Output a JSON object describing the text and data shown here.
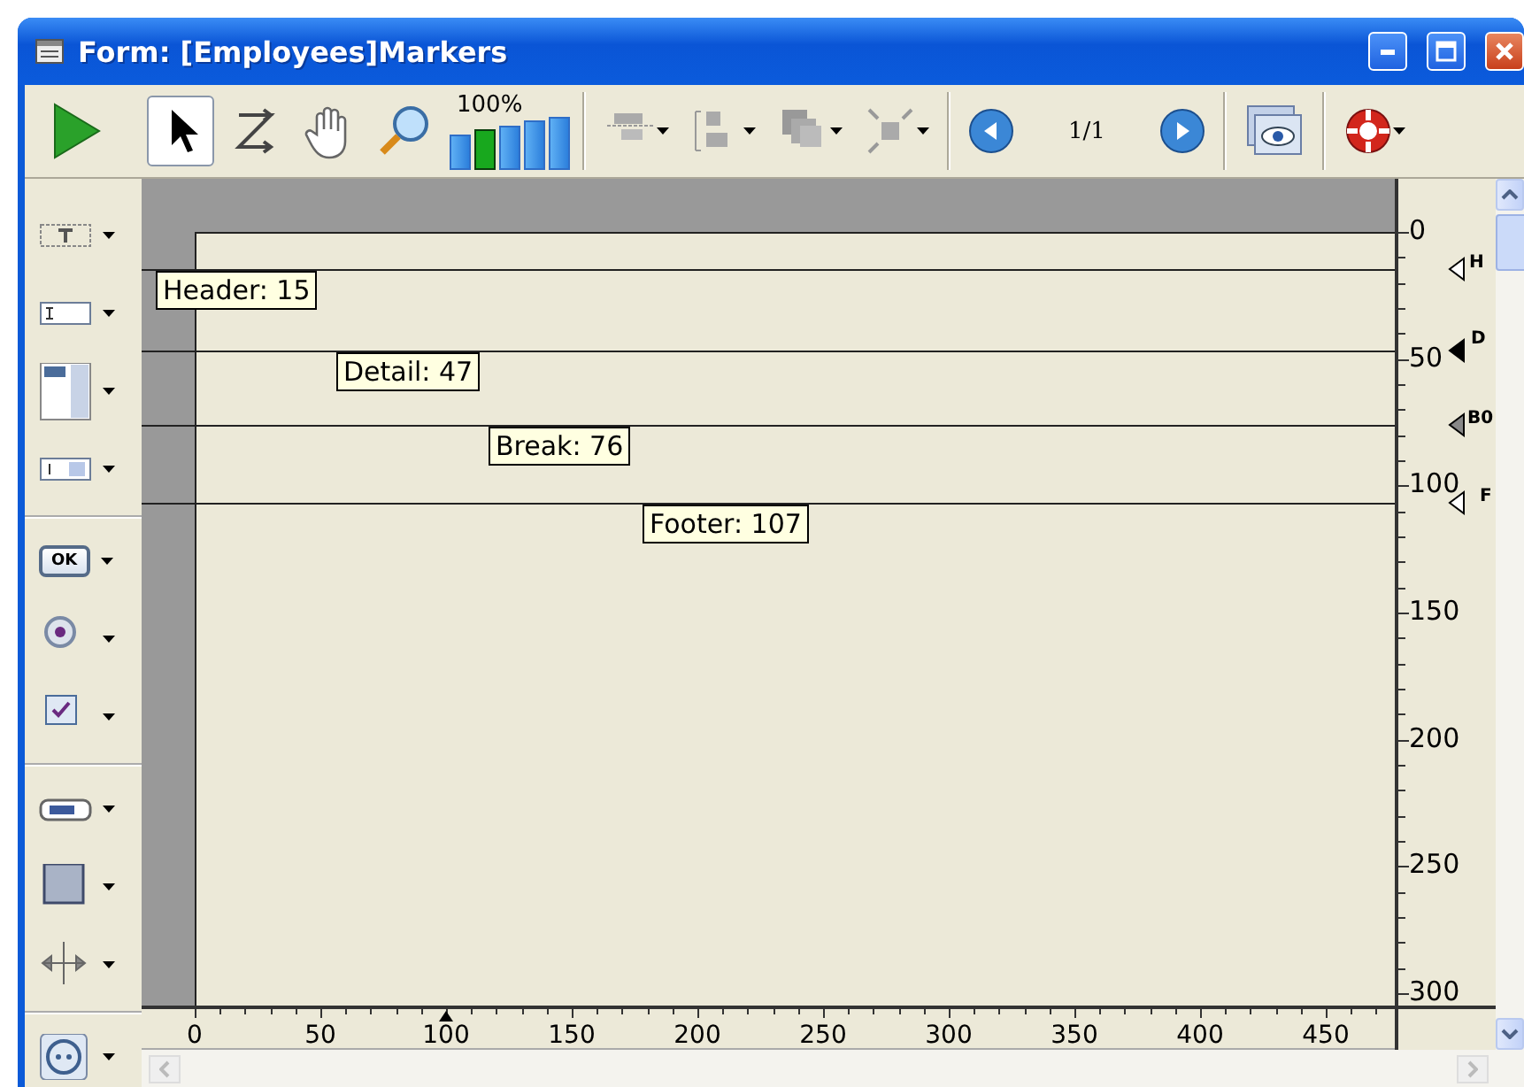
{
  "window": {
    "title": "Form: [Employees]Markers"
  },
  "toolbar": {
    "zoom_label": "100%",
    "zoom_levels": [
      {
        "selected": false
      },
      {
        "selected": true
      },
      {
        "selected": false
      },
      {
        "selected": false
      },
      {
        "selected": false
      }
    ],
    "page": "1/1",
    "pointer_tool": {
      "selected": true
    }
  },
  "palette": {
    "ok_button_label": "OK"
  },
  "markers": [
    {
      "label": "Header: 15",
      "ruler_tag": "H"
    },
    {
      "label": "Detail: 47",
      "ruler_tag": "D"
    },
    {
      "label": "Break: 76",
      "ruler_tag": "B0"
    },
    {
      "label": "Footer: 107",
      "ruler_tag": "F"
    }
  ],
  "vertical_ruler": [
    "0",
    "50",
    "100",
    "150",
    "200",
    "250",
    "300"
  ],
  "horizontal_ruler": [
    "0",
    "50",
    "100",
    "150",
    "200",
    "250",
    "300",
    "350",
    "400",
    "450"
  ]
}
